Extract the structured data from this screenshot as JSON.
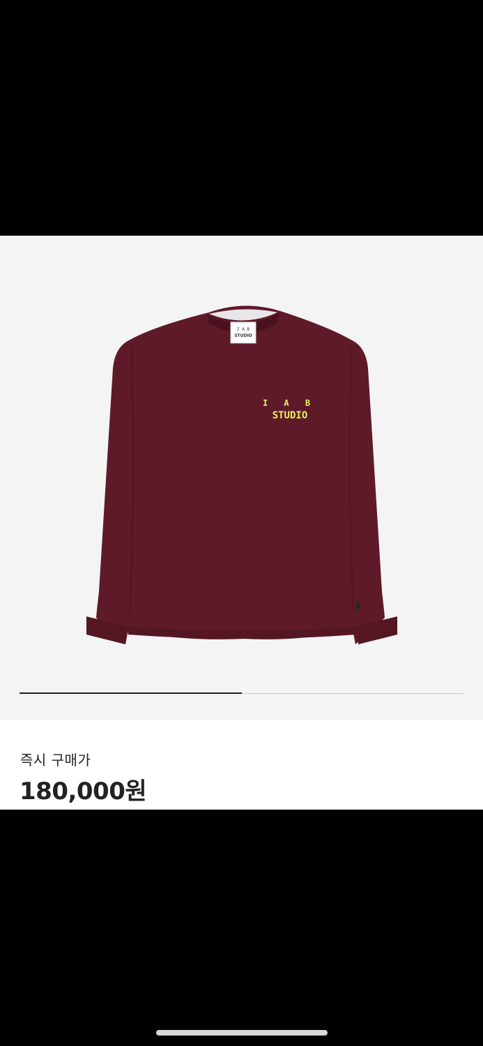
{
  "product": {
    "image_alt": "IAB STUDIO burgundy long sleeve sweatshirt",
    "logo_line1": "I A B",
    "logo_line2": "STUDIO",
    "neck_label_line1": "I A B",
    "neck_label_line2": "STUDIO",
    "garment_color": "#5e1a28",
    "logo_color": "#e6f25a",
    "background_color": "#f4f4f4"
  },
  "carousel": {
    "progress": 0.5
  },
  "price": {
    "label": "즉시 구매가",
    "value": "180,000원"
  }
}
